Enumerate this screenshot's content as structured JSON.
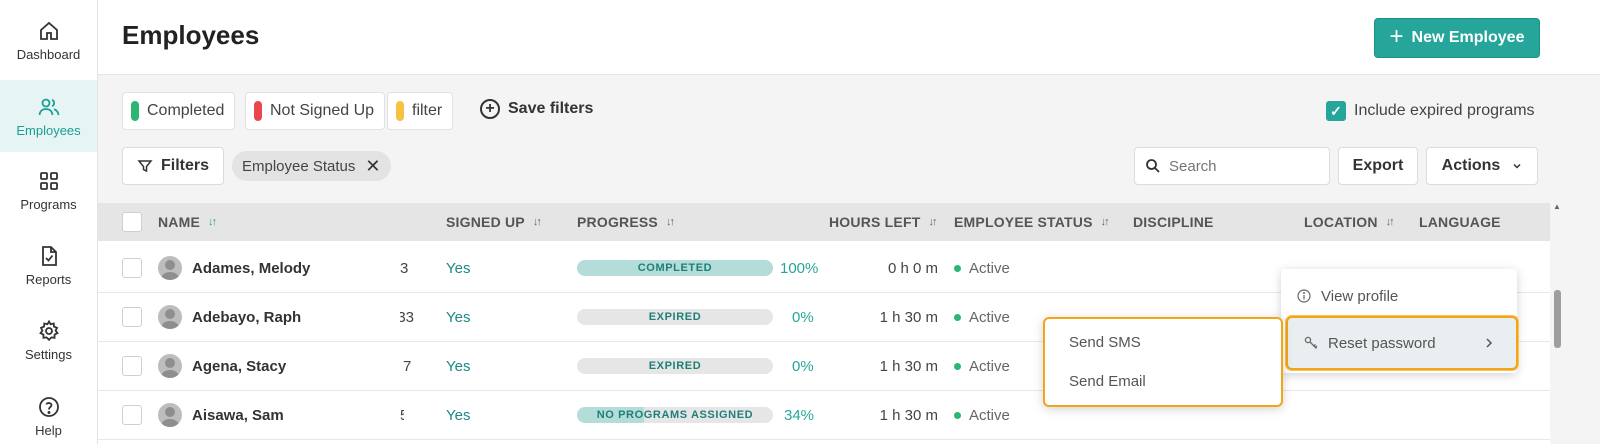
{
  "sidebar": {
    "items": [
      {
        "label": "Dashboard",
        "icon": "home-icon"
      },
      {
        "label": "Employees",
        "icon": "users-icon",
        "active": true
      },
      {
        "label": "Programs",
        "icon": "grid-icon"
      },
      {
        "label": "Reports",
        "icon": "report-icon"
      },
      {
        "label": "Settings",
        "icon": "gear-icon"
      },
      {
        "label": "Help",
        "icon": "help-icon"
      }
    ]
  },
  "header": {
    "title": "Employees",
    "new_button": "New Employee"
  },
  "saved_filters": {
    "chips": [
      {
        "label": "Completed",
        "color": "#2bb673"
      },
      {
        "label": "Not Signed Up",
        "color": "#e8474c"
      },
      {
        "label": "filter",
        "color": "#f5c242"
      }
    ],
    "save_label": "Save filters"
  },
  "include_expired": {
    "label": "Include expired programs",
    "checked": true
  },
  "toolbar": {
    "filters_label": "Filters",
    "active_filter": "Employee Status",
    "search_placeholder": "Search",
    "export_label": "Export",
    "actions_label": "Actions"
  },
  "table": {
    "columns": {
      "name": "NAME",
      "signed_up": "SIGNED UP",
      "progress": "PROGRESS",
      "hours_left": "HOURS LEFT",
      "employee_status": "EMPLOYEE STATUS",
      "discipline": "DISCIPLINE",
      "location": "LOCATION",
      "language": "LANGUAGE"
    },
    "rows": [
      {
        "name": "Adames, Melody",
        "id_fragment": "3",
        "signed_up": "Yes",
        "progress_label": "COMPLETED",
        "progress_pct": "100%",
        "progress_fill": 1.0,
        "hours_left": "0 h 0 m",
        "status": "Active"
      },
      {
        "name": "Adebayo, Raph",
        "id_fragment": "33",
        "signed_up": "Yes",
        "progress_label": "EXPIRED",
        "progress_pct": "0%",
        "progress_fill": 0.0,
        "hours_left": "1 h 30 m",
        "status": "Active"
      },
      {
        "name": "Agena, Stacy",
        "id_fragment": "7",
        "signed_up": "Yes",
        "progress_label": "EXPIRED",
        "progress_pct": "0%",
        "progress_fill": 0.0,
        "hours_left": "1 h 30 m",
        "status": "Active"
      },
      {
        "name": "Aisawa, Sam",
        "id_fragment": "5",
        "signed_up": "Yes",
        "progress_label": "NO PROGRAMS ASSIGNED",
        "progress_pct": "34%",
        "progress_fill": 0.34,
        "hours_left": "1 h 30 m",
        "status": "Active"
      }
    ]
  },
  "context_menu": {
    "view_profile": "View profile",
    "reset_password": "Reset password",
    "submenu": {
      "send_sms": "Send SMS",
      "send_email": "Send Email"
    }
  },
  "colors": {
    "accent": "#26a69a",
    "highlight": "#f2a516",
    "active_status": "#2bb673"
  }
}
